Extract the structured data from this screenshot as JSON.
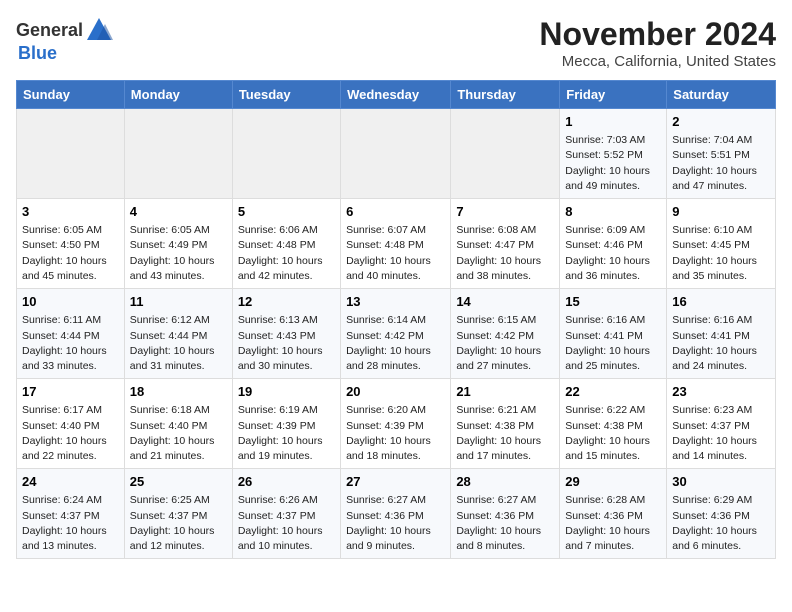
{
  "header": {
    "logo_general": "General",
    "logo_blue": "Blue",
    "title": "November 2024",
    "location": "Mecca, California, United States"
  },
  "calendar": {
    "weekdays": [
      "Sunday",
      "Monday",
      "Tuesday",
      "Wednesday",
      "Thursday",
      "Friday",
      "Saturday"
    ],
    "weeks": [
      [
        {
          "day": "",
          "info": ""
        },
        {
          "day": "",
          "info": ""
        },
        {
          "day": "",
          "info": ""
        },
        {
          "day": "",
          "info": ""
        },
        {
          "day": "",
          "info": ""
        },
        {
          "day": "1",
          "info": "Sunrise: 7:03 AM\nSunset: 5:52 PM\nDaylight: 10 hours\nand 49 minutes."
        },
        {
          "day": "2",
          "info": "Sunrise: 7:04 AM\nSunset: 5:51 PM\nDaylight: 10 hours\nand 47 minutes."
        }
      ],
      [
        {
          "day": "3",
          "info": "Sunrise: 6:05 AM\nSunset: 4:50 PM\nDaylight: 10 hours\nand 45 minutes."
        },
        {
          "day": "4",
          "info": "Sunrise: 6:05 AM\nSunset: 4:49 PM\nDaylight: 10 hours\nand 43 minutes."
        },
        {
          "day": "5",
          "info": "Sunrise: 6:06 AM\nSunset: 4:48 PM\nDaylight: 10 hours\nand 42 minutes."
        },
        {
          "day": "6",
          "info": "Sunrise: 6:07 AM\nSunset: 4:48 PM\nDaylight: 10 hours\nand 40 minutes."
        },
        {
          "day": "7",
          "info": "Sunrise: 6:08 AM\nSunset: 4:47 PM\nDaylight: 10 hours\nand 38 minutes."
        },
        {
          "day": "8",
          "info": "Sunrise: 6:09 AM\nSunset: 4:46 PM\nDaylight: 10 hours\nand 36 minutes."
        },
        {
          "day": "9",
          "info": "Sunrise: 6:10 AM\nSunset: 4:45 PM\nDaylight: 10 hours\nand 35 minutes."
        }
      ],
      [
        {
          "day": "10",
          "info": "Sunrise: 6:11 AM\nSunset: 4:44 PM\nDaylight: 10 hours\nand 33 minutes."
        },
        {
          "day": "11",
          "info": "Sunrise: 6:12 AM\nSunset: 4:44 PM\nDaylight: 10 hours\nand 31 minutes."
        },
        {
          "day": "12",
          "info": "Sunrise: 6:13 AM\nSunset: 4:43 PM\nDaylight: 10 hours\nand 30 minutes."
        },
        {
          "day": "13",
          "info": "Sunrise: 6:14 AM\nSunset: 4:42 PM\nDaylight: 10 hours\nand 28 minutes."
        },
        {
          "day": "14",
          "info": "Sunrise: 6:15 AM\nSunset: 4:42 PM\nDaylight: 10 hours\nand 27 minutes."
        },
        {
          "day": "15",
          "info": "Sunrise: 6:16 AM\nSunset: 4:41 PM\nDaylight: 10 hours\nand 25 minutes."
        },
        {
          "day": "16",
          "info": "Sunrise: 6:16 AM\nSunset: 4:41 PM\nDaylight: 10 hours\nand 24 minutes."
        }
      ],
      [
        {
          "day": "17",
          "info": "Sunrise: 6:17 AM\nSunset: 4:40 PM\nDaylight: 10 hours\nand 22 minutes."
        },
        {
          "day": "18",
          "info": "Sunrise: 6:18 AM\nSunset: 4:40 PM\nDaylight: 10 hours\nand 21 minutes."
        },
        {
          "day": "19",
          "info": "Sunrise: 6:19 AM\nSunset: 4:39 PM\nDaylight: 10 hours\nand 19 minutes."
        },
        {
          "day": "20",
          "info": "Sunrise: 6:20 AM\nSunset: 4:39 PM\nDaylight: 10 hours\nand 18 minutes."
        },
        {
          "day": "21",
          "info": "Sunrise: 6:21 AM\nSunset: 4:38 PM\nDaylight: 10 hours\nand 17 minutes."
        },
        {
          "day": "22",
          "info": "Sunrise: 6:22 AM\nSunset: 4:38 PM\nDaylight: 10 hours\nand 15 minutes."
        },
        {
          "day": "23",
          "info": "Sunrise: 6:23 AM\nSunset: 4:37 PM\nDaylight: 10 hours\nand 14 minutes."
        }
      ],
      [
        {
          "day": "24",
          "info": "Sunrise: 6:24 AM\nSunset: 4:37 PM\nDaylight: 10 hours\nand 13 minutes."
        },
        {
          "day": "25",
          "info": "Sunrise: 6:25 AM\nSunset: 4:37 PM\nDaylight: 10 hours\nand 12 minutes."
        },
        {
          "day": "26",
          "info": "Sunrise: 6:26 AM\nSunset: 4:37 PM\nDaylight: 10 hours\nand 10 minutes."
        },
        {
          "day": "27",
          "info": "Sunrise: 6:27 AM\nSunset: 4:36 PM\nDaylight: 10 hours\nand 9 minutes."
        },
        {
          "day": "28",
          "info": "Sunrise: 6:27 AM\nSunset: 4:36 PM\nDaylight: 10 hours\nand 8 minutes."
        },
        {
          "day": "29",
          "info": "Sunrise: 6:28 AM\nSunset: 4:36 PM\nDaylight: 10 hours\nand 7 minutes."
        },
        {
          "day": "30",
          "info": "Sunrise: 6:29 AM\nSunset: 4:36 PM\nDaylight: 10 hours\nand 6 minutes."
        }
      ]
    ]
  }
}
